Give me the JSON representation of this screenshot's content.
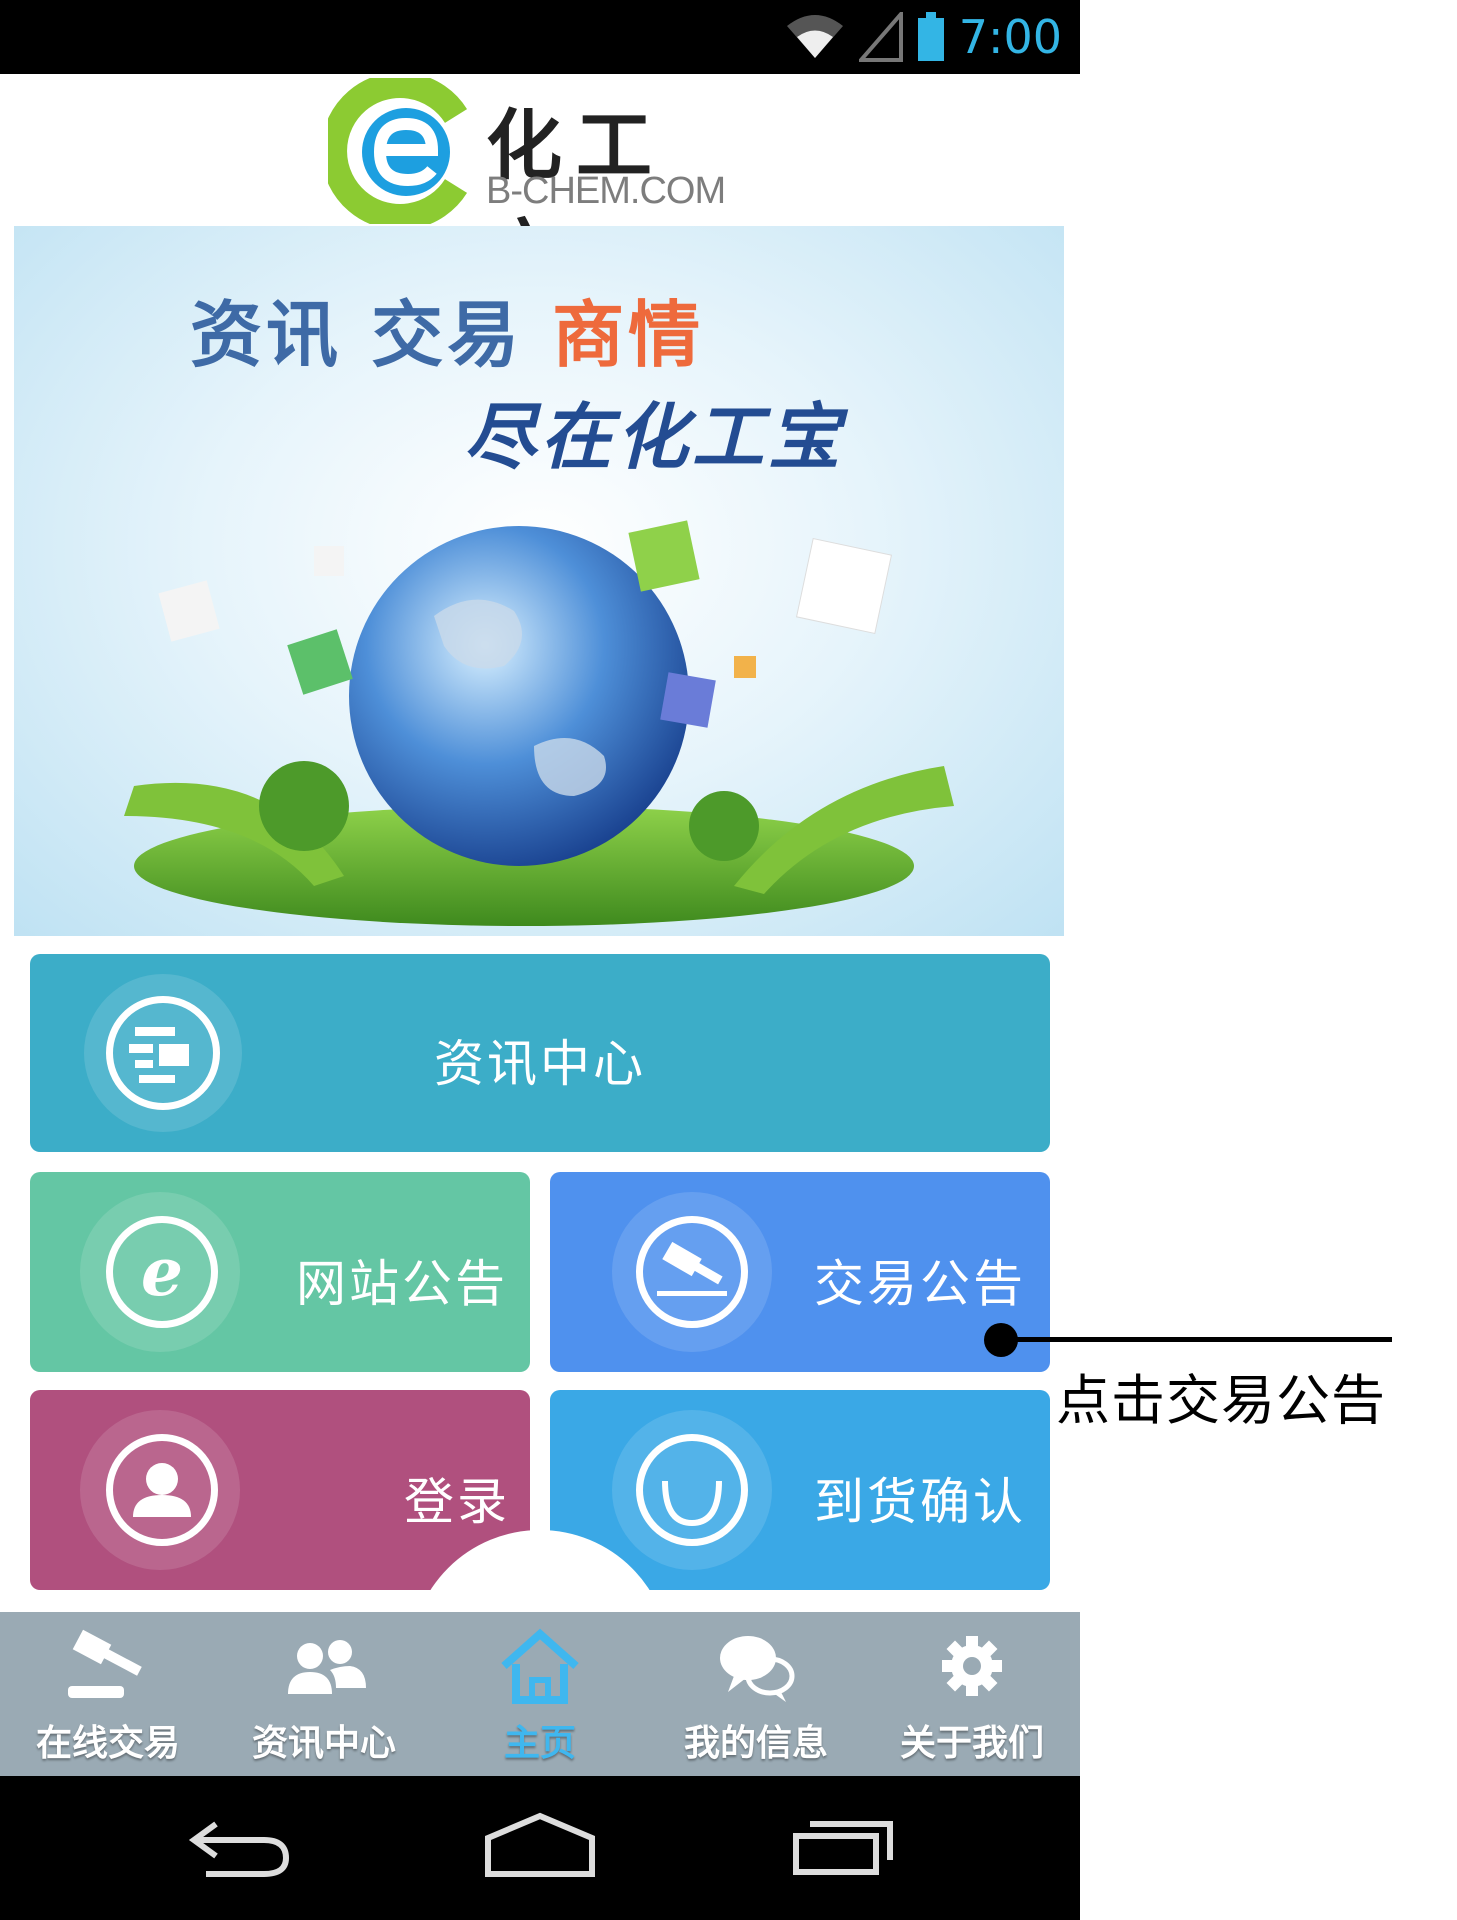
{
  "status_bar": {
    "time": "7:00"
  },
  "header": {
    "logo_cn": "化工宝",
    "logo_en": "B-CHEM.COM"
  },
  "banner": {
    "line1_a": "资讯 交易 ",
    "line1_b": "商情",
    "line2": "尽在化工宝"
  },
  "tiles": {
    "news": "资讯中心",
    "site_notice": "网站公告",
    "trade_notice": "交易公告",
    "login": "登录",
    "arrival": "到货确认"
  },
  "bottom_nav": [
    {
      "label": "在线交易",
      "icon": "gavel-icon"
    },
    {
      "label": "资讯中心",
      "icon": "people-icon"
    },
    {
      "label": "主页",
      "icon": "home-icon",
      "active": true
    },
    {
      "label": "我的信息",
      "icon": "chat-icon"
    },
    {
      "label": "关于我们",
      "icon": "gear-icon"
    }
  ],
  "annotation": {
    "text": "点击交易公告"
  },
  "colors": {
    "news_tile": "#3cadc8",
    "site_tile": "#64c6a4",
    "trade_tile": "#4f91ee",
    "login_tile": "#b0507e",
    "arrival_tile": "#3aa8e6",
    "nav_bg": "#9aaab4",
    "active": "#3fb7ef"
  }
}
